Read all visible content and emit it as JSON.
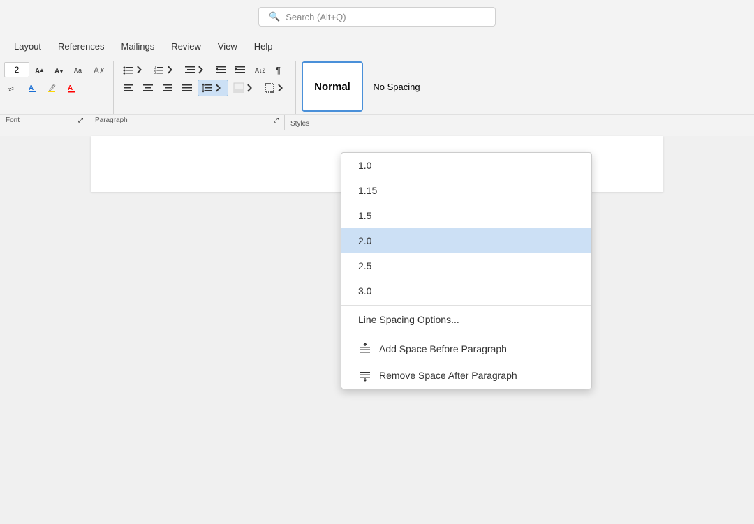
{
  "titlebar": {
    "search_placeholder": "Search (Alt+Q)"
  },
  "menubar": {
    "items": [
      "Layout",
      "References",
      "Mailings",
      "Review",
      "View",
      "Help"
    ]
  },
  "ribbon": {
    "font_size": "2",
    "font_group_label": "Font",
    "para_group_label": "Paragraph",
    "styles_group_label": "Styles"
  },
  "styles": {
    "normal_label": "Normal",
    "nospacing_label": "No Spacing"
  },
  "dropdown": {
    "spacing_values": [
      "1.0",
      "1.15",
      "1.5",
      "2.0",
      "2.5",
      "3.0"
    ],
    "highlighted_index": 3,
    "options_label": "Line Spacing Options...",
    "add_space_label": "Add Space Before Paragraph",
    "remove_space_label": "Remove Space After Paragraph"
  }
}
